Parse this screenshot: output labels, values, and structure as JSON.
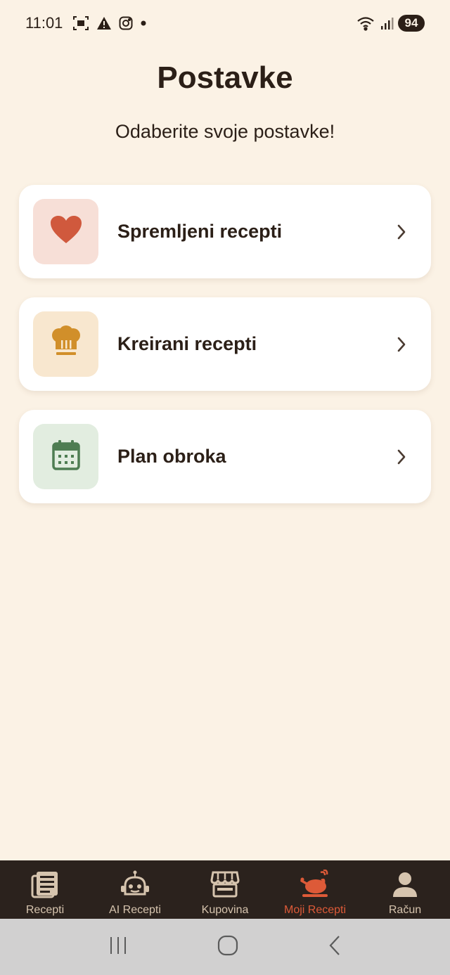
{
  "status_bar": {
    "time": "11:01",
    "battery": "94",
    "icons": [
      "screenshot-icon",
      "warning-icon",
      "instagram-icon",
      "dot-icon",
      "wifi-icon",
      "signal-icon"
    ]
  },
  "header": {
    "title": "Postavke",
    "subtitle": "Odaberite svoje postavke!"
  },
  "settings": {
    "items": [
      {
        "label": "Spremljeni recepti",
        "icon": "heart-icon",
        "icon_color": "#d0593d",
        "tile_color": "#f7dfd7"
      },
      {
        "label": "Kreirani recepti",
        "icon": "chef-hat-icon",
        "icon_color": "#d18f2a",
        "tile_color": "#f8e7cf"
      },
      {
        "label": "Plan obroka",
        "icon": "calendar-icon",
        "icon_color": "#4e7d52",
        "tile_color": "#e2ede0"
      }
    ]
  },
  "bottom_nav": {
    "items": [
      {
        "label": "Recepti",
        "icon": "newspaper-icon",
        "active": false
      },
      {
        "label": "AI Recepti",
        "icon": "robot-icon",
        "active": false
      },
      {
        "label": "Kupovina",
        "icon": "store-icon",
        "active": false
      },
      {
        "label": "Moji Recepti",
        "icon": "roast-chicken-icon",
        "active": true
      },
      {
        "label": "Račun",
        "icon": "user-icon",
        "active": false
      }
    ]
  },
  "colors": {
    "background": "#fbf2e5",
    "nav_background": "#2b221d",
    "nav_inactive": "#d6c4ae",
    "accent": "#dd5a38"
  }
}
